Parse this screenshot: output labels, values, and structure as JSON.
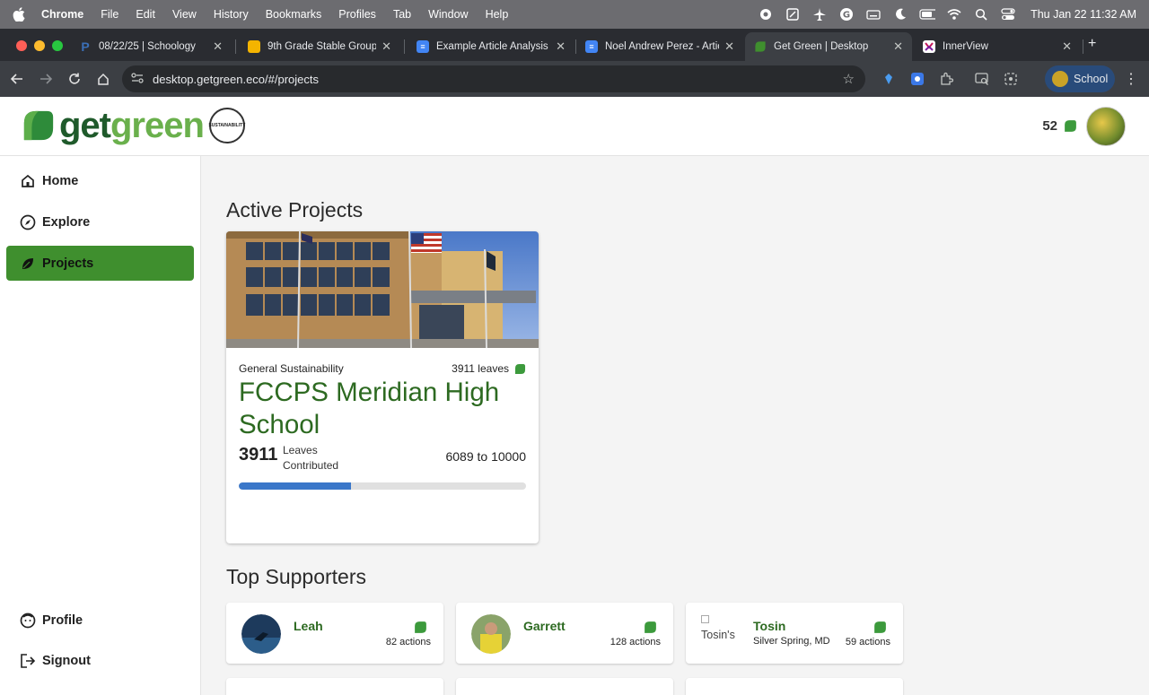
{
  "menubar": {
    "app": "Chrome",
    "items": [
      "File",
      "Edit",
      "View",
      "History",
      "Bookmarks",
      "Profiles",
      "Tab",
      "Window",
      "Help"
    ],
    "clock": "Thu Jan 22  11:32 AM"
  },
  "tabs": [
    {
      "title": "08/22/25 | Schoology",
      "favicon": "schoology-icon",
      "color": "#3b6fb6"
    },
    {
      "title": "9th Grade Stable Group 9",
      "favicon": "slides-icon",
      "color": "#f4b400"
    },
    {
      "title": "Example Article Analysis",
      "favicon": "docs-icon",
      "color": "#4285f4"
    },
    {
      "title": "Noel Andrew Perez - Artic",
      "favicon": "docs-icon",
      "color": "#4285f4"
    },
    {
      "title": "Get Green | Desktop",
      "favicon": "getgreen-icon",
      "color": "#3f8f2e"
    },
    {
      "title": "InnerView",
      "favicon": "innerview-icon",
      "color": "#c2185b"
    }
  ],
  "toolbar": {
    "url": "desktop.getgreen.eco/#/projects",
    "profile_label": "School"
  },
  "header": {
    "logo_part1": "get",
    "logo_part2": "green",
    "seal_text": "SUSTAINABILITY",
    "points": "52"
  },
  "sidebar": {
    "items": [
      {
        "label": "Home",
        "icon": "home-icon"
      },
      {
        "label": "Explore",
        "icon": "compass-icon"
      },
      {
        "label": "Projects",
        "icon": "leaf-icon"
      }
    ],
    "bottom": [
      {
        "label": "Profile",
        "icon": "face-icon"
      },
      {
        "label": "Signout",
        "icon": "signout-icon"
      }
    ]
  },
  "main": {
    "active_heading": "Active Projects",
    "project": {
      "category": "General Sustainability",
      "leaves_label": "3911 leaves",
      "title": "FCCPS Meridian High School",
      "contributed": "3911",
      "contributed_label": "Leaves Contributed",
      "range": "6089 to 10000",
      "progress": 0.391
    },
    "supporters_heading": "Top Supporters",
    "supporters": [
      {
        "name": "Leah",
        "location": "",
        "actions": "82 actions"
      },
      {
        "name": "Garrett",
        "location": "",
        "actions": "128 actions"
      },
      {
        "name": "Tosin",
        "location": "Silver Spring, MD",
        "actions": "59 actions",
        "alt": "Tosin's"
      }
    ]
  },
  "colors": {
    "brand_dark": "#1f5a2b",
    "brand_light": "#6ab04c",
    "nav_active": "#3f8f2e",
    "progress": "#3a77c9"
  }
}
